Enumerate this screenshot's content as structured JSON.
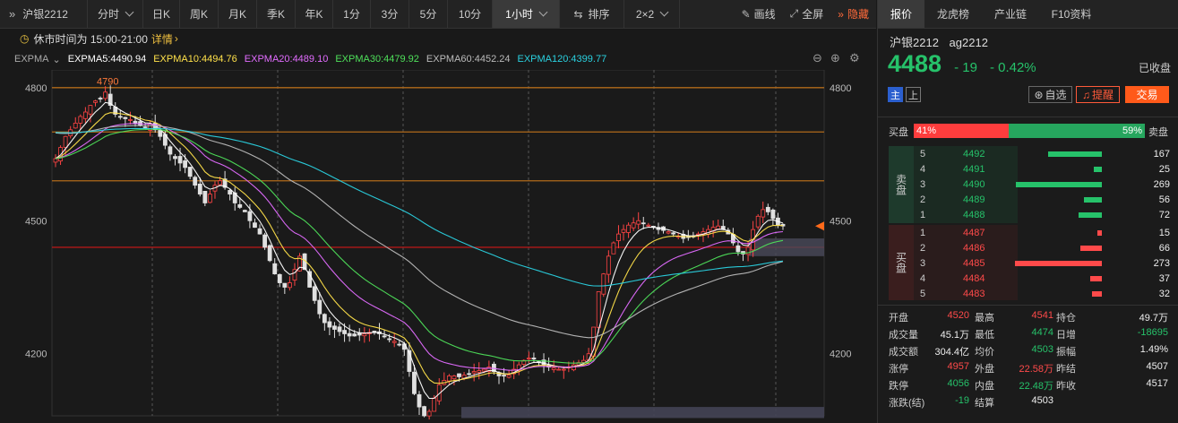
{
  "toolbar": {
    "symbol": "沪银2212",
    "fenshi": "分时",
    "periods": [
      "日K",
      "周K",
      "月K",
      "季K",
      "年K",
      "1分",
      "3分",
      "5分",
      "10分"
    ],
    "active_period": "1小时",
    "sort": "排序",
    "grid": "2×2",
    "draw": "画线",
    "fullscreen": "全屏",
    "hide": "隐藏"
  },
  "info": {
    "text": "休市时间为 15:00-21:00",
    "link": "详情"
  },
  "legend": {
    "name": "EXPMA",
    "items": [
      {
        "label": "EXPMA5:4490.94",
        "color": "#ffffff"
      },
      {
        "label": "EXPMA10:4494.76",
        "color": "#ffe14a"
      },
      {
        "label": "EXPMA20:4489.10",
        "color": "#e26cff"
      },
      {
        "label": "EXPMA30:4479.92",
        "color": "#4ee05a"
      },
      {
        "label": "EXPMA60:4452.24",
        "color": "#bbbbbb"
      },
      {
        "label": "EXPMA120:4399.77",
        "color": "#2ad1e0"
      }
    ]
  },
  "chart_data": {
    "type": "candlestick",
    "yticks": [
      "4800",
      "4500",
      "4200"
    ],
    "annot_high": "4790",
    "annot_low": "4018",
    "price_marker": "4488",
    "ylim": [
      4060,
      4840
    ],
    "closes": [
      4640,
      4665,
      4690,
      4705,
      4720,
      4735,
      4745,
      4760,
      4770,
      4775,
      4790,
      4760,
      4740,
      4735,
      4730,
      4728,
      4720,
      4715,
      4710,
      4718,
      4705,
      4690,
      4670,
      4650,
      4640,
      4630,
      4620,
      4600,
      4580,
      4560,
      4540,
      4560,
      4580,
      4590,
      4575,
      4560,
      4540,
      4530,
      4520,
      4500,
      4485,
      4470,
      4440,
      4410,
      4380,
      4360,
      4350,
      4360,
      4390,
      4420,
      4390,
      4350,
      4320,
      4290,
      4270,
      4260,
      4255,
      4250,
      4245,
      4240,
      4240,
      4242,
      4245,
      4248,
      4250,
      4245,
      4238,
      4232,
      4228,
      4220,
      4210,
      4160,
      4110,
      4080,
      4060,
      4070,
      4100,
      4130,
      4140,
      4150,
      4150,
      4148,
      4152,
      4155,
      4160,
      4162,
      4165,
      4170,
      4160,
      4150,
      4150,
      4152,
      4165,
      4175,
      4185,
      4190,
      4188,
      4180,
      4175,
      4170,
      4168,
      4165,
      4165,
      4170,
      4175,
      4180,
      4185,
      4200,
      4260,
      4340,
      4380,
      4420,
      4450,
      4470,
      4480,
      4490,
      4495,
      4500,
      4495,
      4490,
      4485,
      4480,
      4478,
      4475,
      4470,
      4465,
      4460,
      4462,
      4465,
      4470,
      4475,
      4480,
      4485,
      4488,
      4480,
      4470,
      4450,
      4430,
      4425,
      4440,
      4480,
      4510,
      4525,
      4520,
      4505,
      4490,
      4488
    ]
  },
  "panel": {
    "tabs": [
      "报价",
      "龙虎榜",
      "产业链",
      "F10资料"
    ],
    "symbol": "沪银2212",
    "code": "ag2212",
    "price": "4488",
    "change": "- 19",
    "pct": "- 0.42%",
    "status": "已收盘",
    "badges": [
      "主",
      "上"
    ],
    "btn_watch": "自选",
    "btn_alert": "提醒",
    "btn_trade": "交易",
    "buy_label": "买盘",
    "sell_label": "卖盘",
    "buy_pct": "41%",
    "sell_pct": "59%",
    "buy_frac": 0.41,
    "ask_group": "卖盘",
    "bid_group": "买盘",
    "asks": [
      {
        "lvl": "5",
        "price": "4492",
        "vol": "167"
      },
      {
        "lvl": "4",
        "price": "4491",
        "vol": "25"
      },
      {
        "lvl": "3",
        "price": "4490",
        "vol": "269"
      },
      {
        "lvl": "2",
        "price": "4489",
        "vol": "56"
      },
      {
        "lvl": "1",
        "price": "4488",
        "vol": "72"
      }
    ],
    "bids": [
      {
        "lvl": "1",
        "price": "4487",
        "vol": "15"
      },
      {
        "lvl": "2",
        "price": "4486",
        "vol": "66"
      },
      {
        "lvl": "3",
        "price": "4485",
        "vol": "273"
      },
      {
        "lvl": "4",
        "price": "4484",
        "vol": "37"
      },
      {
        "lvl": "5",
        "price": "4483",
        "vol": "32"
      }
    ],
    "stats": [
      [
        {
          "k": "开盘",
          "v": "4520",
          "c": "red"
        },
        {
          "k": "最高",
          "v": "4541",
          "c": "red"
        },
        {
          "k": "持仓",
          "v": "49.7万",
          "c": "white"
        }
      ],
      [
        {
          "k": "成交量",
          "v": "45.1万",
          "c": "white"
        },
        {
          "k": "最低",
          "v": "4474",
          "c": "green"
        },
        {
          "k": "日增",
          "v": "-18695",
          "c": "green"
        }
      ],
      [
        {
          "k": "成交额",
          "v": "304.4亿",
          "c": "white"
        },
        {
          "k": "均价",
          "v": "4503",
          "c": "green"
        },
        {
          "k": "振幅",
          "v": "1.49%",
          "c": "white"
        }
      ],
      [
        {
          "k": "涨停",
          "v": "4957",
          "c": "red"
        },
        {
          "k": "外盘",
          "v": "22.58万",
          "c": "red"
        },
        {
          "k": "昨结",
          "v": "4507",
          "c": "white"
        }
      ],
      [
        {
          "k": "跌停",
          "v": "4056",
          "c": "green"
        },
        {
          "k": "内盘",
          "v": "22.48万",
          "c": "green"
        },
        {
          "k": "昨收",
          "v": "4517",
          "c": "white"
        }
      ],
      [
        {
          "k": "涨跌(结)",
          "v": "-19",
          "c": "green"
        },
        {
          "k": "结算",
          "v": "4503",
          "c": "white"
        },
        {
          "k": "",
          "v": "",
          "c": "white"
        }
      ]
    ]
  }
}
